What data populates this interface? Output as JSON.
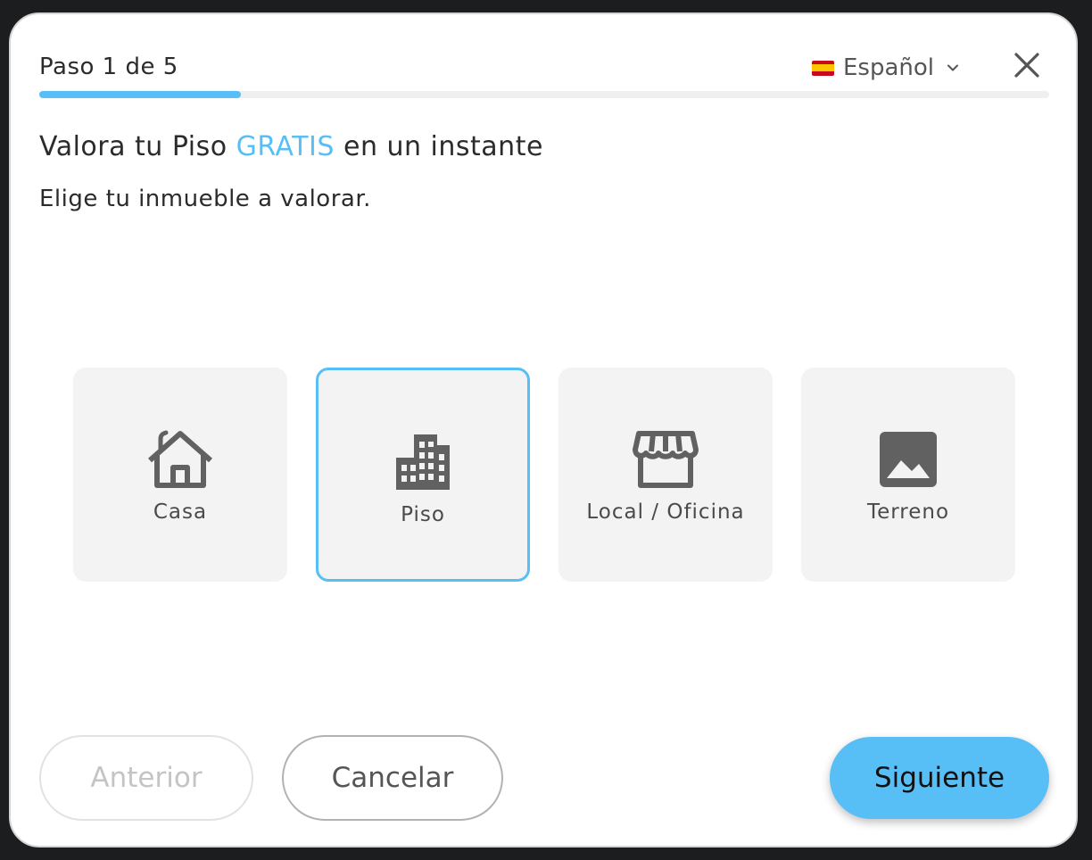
{
  "header": {
    "step_label": "Paso 1 de 5",
    "progress": 0.2,
    "language": "Español",
    "language_flag": "spain-flag-icon",
    "close_icon": "close-icon"
  },
  "main": {
    "headline_prefix": "Valora tu Piso",
    "headline_accent": "GRATIS",
    "headline_suffix": "en un instante",
    "subtitle": "Elige tu inmueble a valorar."
  },
  "options": [
    {
      "label": "Casa",
      "icon": "house-icon",
      "selected": false
    },
    {
      "label": "Piso",
      "icon": "building-icon",
      "selected": true
    },
    {
      "label": "Local / Oficina",
      "icon": "storefront-icon",
      "selected": false
    },
    {
      "label": "Terreno",
      "icon": "landscape-icon",
      "selected": false
    }
  ],
  "footer": {
    "prev_label": "Anterior",
    "cancel_label": "Cancelar",
    "next_label": "Siguiente"
  },
  "colors": {
    "accent": "#58bff6",
    "option_bg": "#f3f3f3",
    "icon": "#616161",
    "text": "#2b2b2b"
  }
}
